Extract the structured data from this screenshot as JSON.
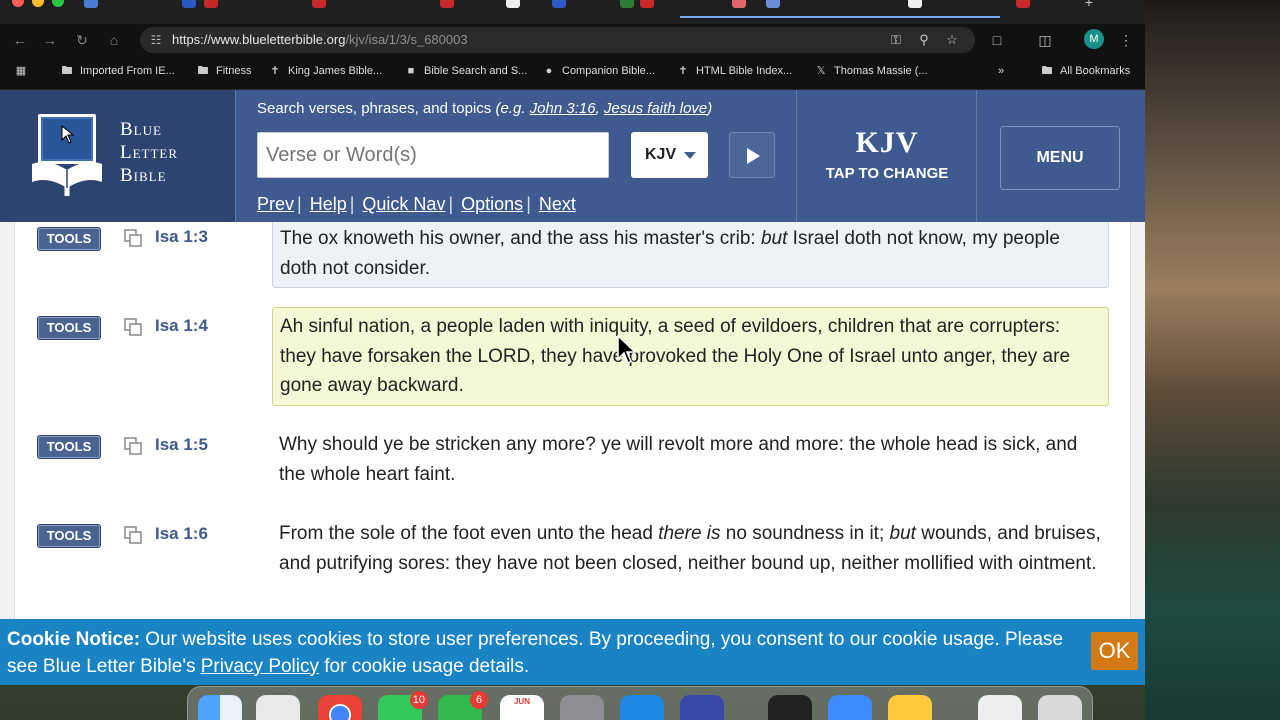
{
  "browser": {
    "url_host": "https://www.blueletterbible.org",
    "url_path": "/kjv/isa/1/3/s_680003",
    "profile_initial": "M",
    "bookmarks": [
      {
        "label": "Imported From IE...",
        "icon": "folder-icon"
      },
      {
        "label": "Fitness",
        "icon": "folder-icon"
      },
      {
        "label": "King James Bible...",
        "icon": "cross-icon"
      },
      {
        "label": "Bible Search and S...",
        "icon": "site-icon"
      },
      {
        "label": "Companion Bible...",
        "icon": "site-icon"
      },
      {
        "label": "HTML Bible Index...",
        "icon": "cross-icon"
      },
      {
        "label": "Thomas Massie (...",
        "icon": "x-icon"
      }
    ],
    "more_bookmarks": "»",
    "all_bookmarks": "All Bookmarks"
  },
  "site": {
    "logo_line1": "Blue",
    "logo_line2": "Letter",
    "logo_line3": "Bible",
    "search_hint_prefix": "Search verses, phrases, and topics",
    "search_hint_eg": "(e.g.",
    "search_hint_ex1": "John 3:16",
    "search_hint_comma": ",",
    "search_hint_ex2": "Jesus faith love",
    "search_hint_close": ")",
    "search_placeholder": "Verse or Word(s)",
    "version_select": "KJV",
    "nav": [
      "Prev",
      "Help",
      "Quick Nav",
      "Options",
      "Next"
    ],
    "version_big": "KJV",
    "version_tap": "TAP TO CHANGE",
    "menu_label": "MENU"
  },
  "verses": [
    {
      "tools": "TOOLS",
      "ref": "Isa 1:3",
      "style": "prev",
      "segments": [
        {
          "t": "The ox knoweth his owner, and the ass his master's crib: "
        },
        {
          "t": "but",
          "i": true
        },
        {
          "t": " Israel doth not know, my people doth not consider."
        }
      ]
    },
    {
      "tools": "TOOLS",
      "ref": "Isa 1:4",
      "style": "current",
      "segments": [
        {
          "t": "Ah sinful nation, a people laden with iniquity, a seed of evildoers, children that are corrupters: they have forsaken the LORD, they have provoked the Holy One of Israel unto anger, they are gone away backward."
        }
      ]
    },
    {
      "tools": "TOOLS",
      "ref": "Isa 1:5",
      "style": "plain",
      "segments": [
        {
          "t": "Why should ye be stricken any more? ye will revolt more and more: the whole head is sick, and the whole heart faint."
        }
      ]
    },
    {
      "tools": "TOOLS",
      "ref": "Isa 1:6",
      "style": "plain",
      "segments": [
        {
          "t": "From the sole of the foot even unto the head "
        },
        {
          "t": "there is",
          "i": true
        },
        {
          "t": " no soundness in it; "
        },
        {
          "t": "but",
          "i": true
        },
        {
          "t": " wounds, and bruises, and putrifying sores: they have not been closed, neither bound up, neither mollified with ointment."
        }
      ]
    }
  ],
  "cookie": {
    "title": "Cookie Notice:",
    "text_before": " Our website uses cookies to store user preferences. By proceeding, you consent to our cookie usage. Please see Blue Letter Bible's ",
    "link": "Privacy Policy",
    "text_after": " for cookie usage details.",
    "ok": "OK"
  },
  "dock": {
    "messages_badge": "10",
    "facetime_badge": "6",
    "calendar_month": "JUN"
  },
  "colors": {
    "header_blue": "#3e5a8e",
    "cookie_blue": "#1983c4",
    "ok_orange": "#d27a16",
    "current_verse_bg": "#f5f8d6"
  }
}
